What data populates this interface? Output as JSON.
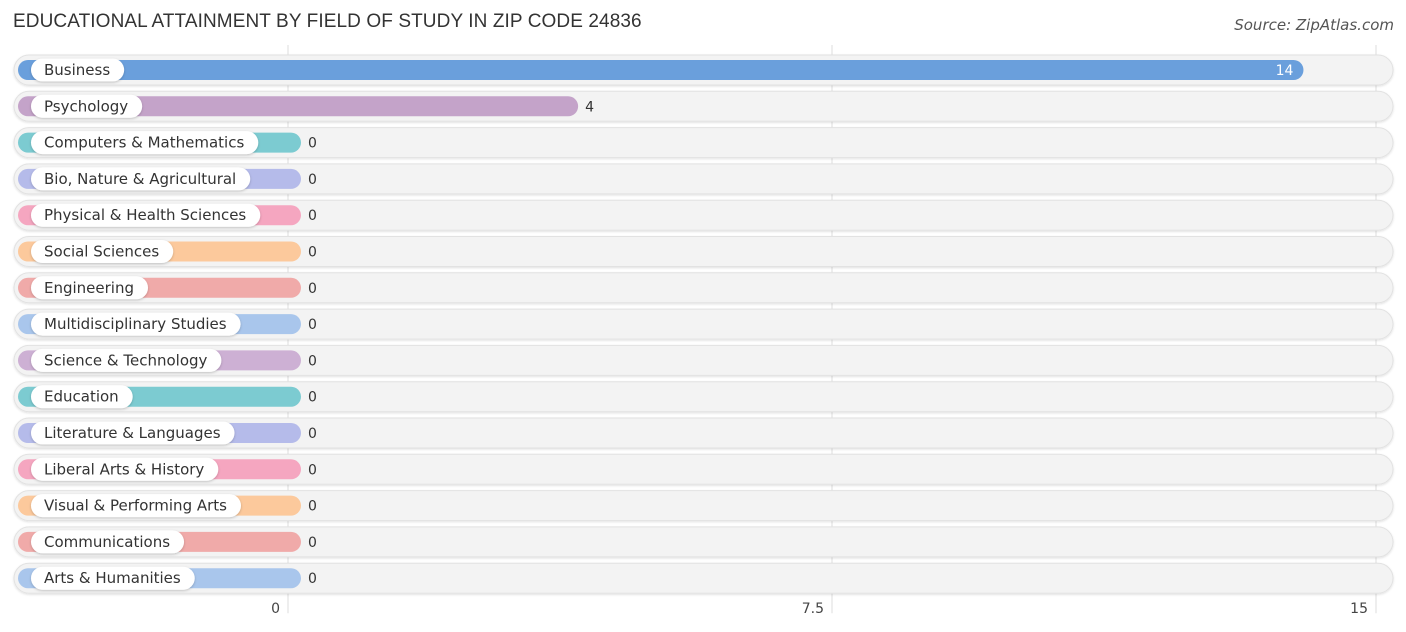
{
  "chart_data": {
    "type": "bar",
    "orientation": "horizontal",
    "title": "EDUCATIONAL ATTAINMENT BY FIELD OF STUDY IN ZIP CODE 24836",
    "source": "Source: ZipAtlas.com",
    "xlabel": "",
    "ylabel": "",
    "xlim": [
      0,
      15
    ],
    "xticks": [
      0,
      7.5,
      15
    ],
    "xtick_labels": [
      "0",
      "7.5",
      "15"
    ],
    "grid": true,
    "categories": [
      "Business",
      "Psychology",
      "Computers & Mathematics",
      "Bio, Nature & Agricultural",
      "Physical & Health Sciences",
      "Social Sciences",
      "Engineering",
      "Multidisciplinary Studies",
      "Science & Technology",
      "Education",
      "Literature & Languages",
      "Liberal Arts & History",
      "Visual & Performing Arts",
      "Communications",
      "Arts & Humanities"
    ],
    "values": [
      14,
      4,
      0,
      0,
      0,
      0,
      0,
      0,
      0,
      0,
      0,
      0,
      0,
      0,
      0
    ],
    "value_labels": [
      "14",
      "4",
      "0",
      "0",
      "0",
      "0",
      "0",
      "0",
      "0",
      "0",
      "0",
      "0",
      "0",
      "0",
      "0"
    ],
    "colors": [
      "#6a9fdc",
      "#c4a3c9",
      "#7ccbd1",
      "#b5bbea",
      "#f5a6c0",
      "#fcc99c",
      "#f0aaa9",
      "#a9c6ec",
      "#cdb0d4",
      "#7ccbd1",
      "#b5bbea",
      "#f5a6c0",
      "#fcc99c",
      "#f0aaa9",
      "#a9c6ec"
    ]
  }
}
